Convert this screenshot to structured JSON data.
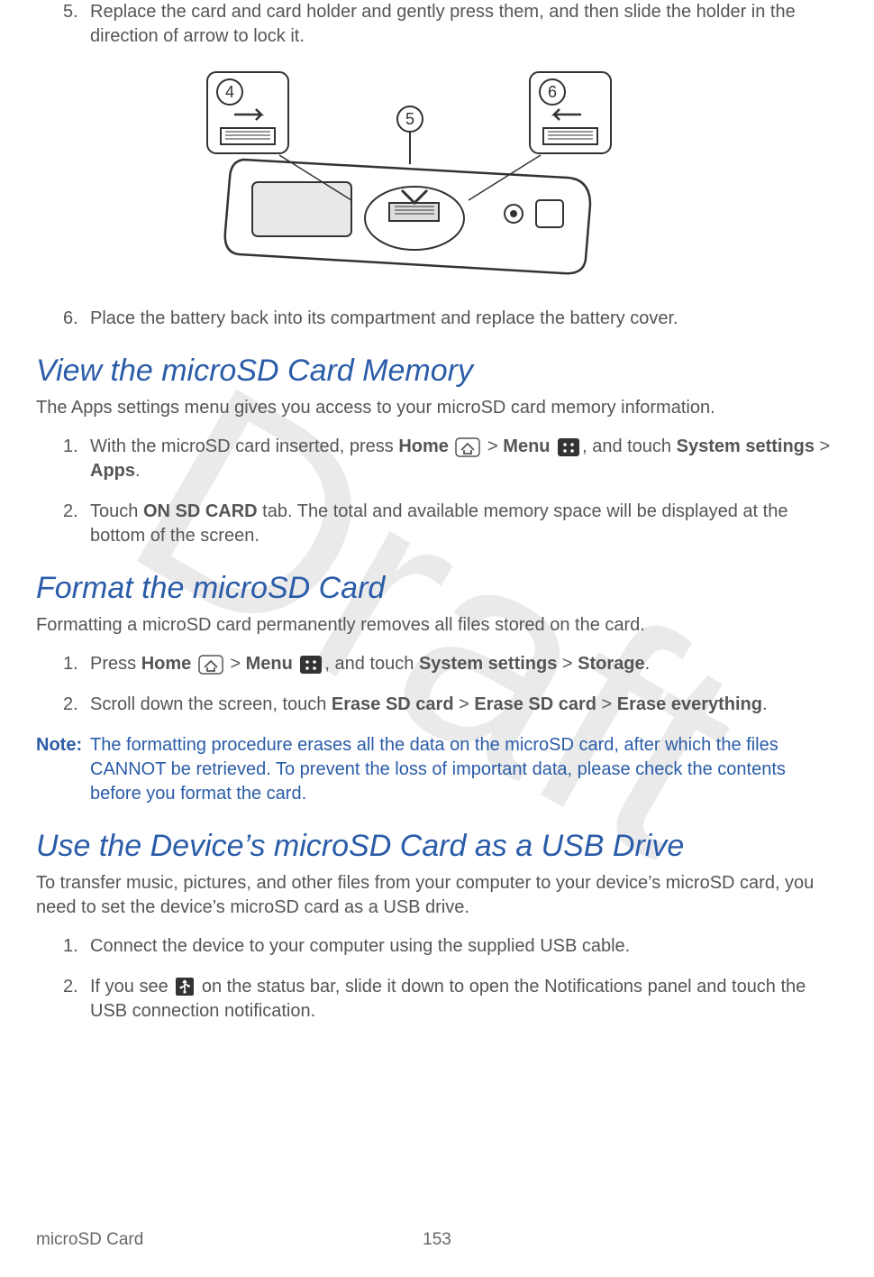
{
  "watermark": "Draft",
  "intro_steps": {
    "s5": {
      "num": "5.",
      "text": "Replace the card and card holder and gently press them, and then slide the holder in the direction of arrow to lock it."
    },
    "s6": {
      "num": "6.",
      "text": "Place the battery back into its compartment and replace the battery cover."
    }
  },
  "diagram": {
    "label4": "4",
    "label5": "5",
    "label6": "6"
  },
  "section_view": {
    "title": "View the microSD Card Memory",
    "lead": "The Apps settings menu gives you access to your microSD card memory information.",
    "s1": {
      "num": "1.",
      "pre": "With the microSD card inserted, press ",
      "home": "Home",
      "gt1": " > ",
      "menu": "Menu",
      "post": ", and touch ",
      "syssettings": "System settings",
      "gt2": " > ",
      "apps": "Apps",
      "end": "."
    },
    "s2": {
      "num": "2.",
      "pre": "Touch ",
      "tab": "ON SD CARD",
      "post": " tab. The total and available memory space will be displayed at the bottom of the screen."
    }
  },
  "section_format": {
    "title": "Format the microSD Card",
    "lead": "Formatting a microSD card permanently removes all files stored on the card.",
    "s1": {
      "num": "1.",
      "pre": "Press ",
      "home": "Home",
      "gt1": " > ",
      "menu": "Menu",
      "post": ", and touch ",
      "syssettings": "System settings",
      "gt2": " > ",
      "storage": "Storage",
      "end": "."
    },
    "s2": {
      "num": "2.",
      "pre": "Scroll down the screen, touch ",
      "e1": "Erase SD card",
      "gt1": " > ",
      "e2": "Erase SD card",
      "gt2": " > ",
      "e3": "Erase everything",
      "end": "."
    },
    "note": {
      "label": "Note:",
      "text": "The formatting procedure erases all the data on the microSD card, after which the files CANNOT be retrieved. To prevent the loss of important data, please check the contents before you format the card."
    }
  },
  "section_usb": {
    "title": "Use the Device’s microSD Card as a USB Drive",
    "lead": "To transfer music, pictures, and other files from your computer to your device’s microSD card, you need to set the device’s microSD card as a USB drive.",
    "s1": {
      "num": "1.",
      "text": "Connect the device to your computer using the supplied USB cable."
    },
    "s2": {
      "num": "2.",
      "pre": "If you see ",
      "post": " on the status bar, slide it down to open the Notifications panel and touch the USB connection notification."
    }
  },
  "footer": {
    "section": "microSD Card",
    "page": "153"
  }
}
